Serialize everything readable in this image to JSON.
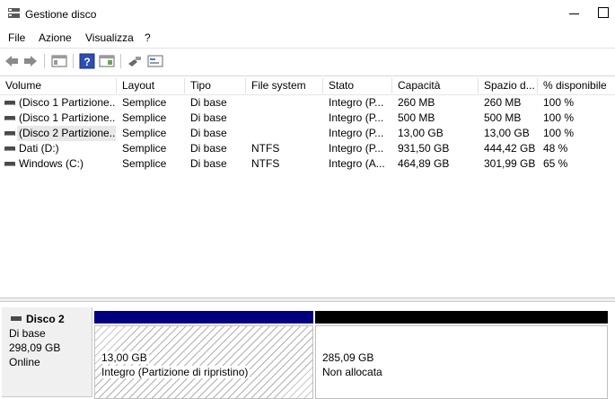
{
  "window": {
    "title": "Gestione disco"
  },
  "menu": [
    "File",
    "Azione",
    "Visualizza",
    "?"
  ],
  "toolbar": {
    "icons": [
      "back-arrow-icon",
      "forward-arrow-icon",
      "console-tree-icon",
      "help-icon",
      "properties-icon",
      "connect-icon",
      "settings-icon"
    ]
  },
  "columns": [
    "Volume",
    "Layout",
    "Tipo",
    "File system",
    "Stato",
    "Capacità",
    "Spazio d...",
    "% disponibile"
  ],
  "volumes": [
    {
      "volume": "(Disco 1 Partizione...",
      "layout": "Semplice",
      "tipo": "Di base",
      "fs": "",
      "stato": "Integro (P...",
      "capacita": "260 MB",
      "spazio": "260 MB",
      "disp": "100 %"
    },
    {
      "volume": "(Disco 1 Partizione...",
      "layout": "Semplice",
      "tipo": "Di base",
      "fs": "",
      "stato": "Integro (P...",
      "capacita": "500 MB",
      "spazio": "500 MB",
      "disp": "100 %"
    },
    {
      "volume": "(Disco 2 Partizione...",
      "layout": "Semplice",
      "tipo": "Di base",
      "fs": "",
      "stato": "Integro (P...",
      "capacita": "13,00 GB",
      "spazio": "13,00 GB",
      "disp": "100 %"
    },
    {
      "volume": "Dati (D:)",
      "layout": "Semplice",
      "tipo": "Di base",
      "fs": "NTFS",
      "stato": "Integro (P...",
      "capacita": "931,50 GB",
      "spazio": "444,42 GB",
      "disp": "48 %"
    },
    {
      "volume": "Windows (C:)",
      "layout": "Semplice",
      "tipo": "Di base",
      "fs": "NTFS",
      "stato": "Integro (A...",
      "capacita": "464,89 GB",
      "spazio": "301,99 GB",
      "disp": "65 %"
    }
  ],
  "disk": {
    "name": "Disco 2",
    "type": "Di base",
    "size": "298,09 GB",
    "status": "Online"
  },
  "partitions": [
    {
      "size": "13,00 GB",
      "status": "Integro (Partizione di ripristino)",
      "bar_color": "#00007f"
    },
    {
      "size": "285,09 GB",
      "status": "Non allocata",
      "bar_color": "#000000"
    }
  ]
}
